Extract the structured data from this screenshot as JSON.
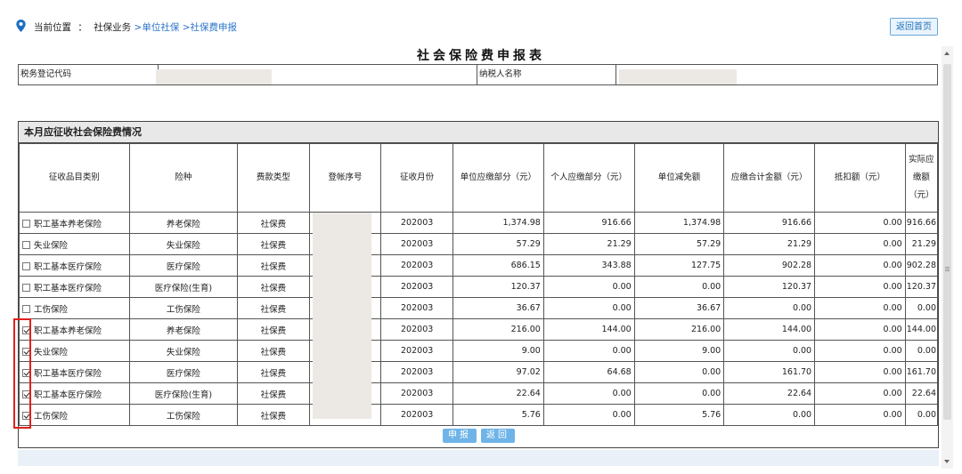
{
  "breadcrumb": {
    "label": "当前位置",
    "colon": "：",
    "static_item": "社保业务",
    "links": [
      ">单位社保",
      ">社保费申报"
    ]
  },
  "header": {
    "home_button": "返回首页"
  },
  "form": {
    "title": "社会保险费申报表",
    "tax_code_label": "税务登记代码",
    "taxpayer_name_label": "纳税人名称"
  },
  "section": {
    "title": "本月应征收社会保险费情况",
    "columns": [
      "征收品目类别",
      "险种",
      "费款类型",
      "登帐序号",
      "征收月份",
      "单位应缴部分（元）",
      "个人应缴部分（元）",
      "单位减免额",
      "应缴合计金额（元）",
      "抵扣额（元）",
      "实际应缴额（元）"
    ],
    "rows": [
      {
        "checked": false,
        "category": "职工基本养老保险",
        "insurance": "养老保险",
        "fee_type": "社保费",
        "month": "202003",
        "unit": "1,374.98",
        "personal": "916.66",
        "unit_relief": "1,374.98",
        "total": "916.66",
        "deduction": "0.00",
        "actual": "916.66"
      },
      {
        "checked": false,
        "category": "失业保险",
        "insurance": "失业保险",
        "fee_type": "社保费",
        "month": "202003",
        "unit": "57.29",
        "personal": "21.29",
        "unit_relief": "57.29",
        "total": "21.29",
        "deduction": "0.00",
        "actual": "21.29"
      },
      {
        "checked": false,
        "category": "职工基本医疗保险",
        "insurance": "医疗保险",
        "fee_type": "社保费",
        "month": "202003",
        "unit": "686.15",
        "personal": "343.88",
        "unit_relief": "127.75",
        "total": "902.28",
        "deduction": "0.00",
        "actual": "902.28"
      },
      {
        "checked": false,
        "category": "职工基本医疗保险",
        "insurance": "医疗保险(生育)",
        "fee_type": "社保费",
        "month": "202003",
        "unit": "120.37",
        "personal": "0.00",
        "unit_relief": "0.00",
        "total": "120.37",
        "deduction": "0.00",
        "actual": "120.37"
      },
      {
        "checked": false,
        "category": "工伤保险",
        "insurance": "工伤保险",
        "fee_type": "社保费",
        "month": "202003",
        "unit": "36.67",
        "personal": "0.00",
        "unit_relief": "36.67",
        "total": "0.00",
        "deduction": "0.00",
        "actual": "0.00"
      },
      {
        "checked": true,
        "category": "职工基本养老保险",
        "insurance": "养老保险",
        "fee_type": "社保费",
        "month": "202003",
        "unit": "216.00",
        "personal": "144.00",
        "unit_relief": "216.00",
        "total": "144.00",
        "deduction": "0.00",
        "actual": "144.00"
      },
      {
        "checked": true,
        "category": "失业保险",
        "insurance": "失业保险",
        "fee_type": "社保费",
        "month": "202003",
        "unit": "9.00",
        "personal": "0.00",
        "unit_relief": "9.00",
        "total": "0.00",
        "deduction": "0.00",
        "actual": "0.00"
      },
      {
        "checked": true,
        "category": "职工基本医疗保险",
        "insurance": "医疗保险",
        "fee_type": "社保费",
        "month": "202003",
        "unit": "97.02",
        "personal": "64.68",
        "unit_relief": "0.00",
        "total": "161.70",
        "deduction": "0.00",
        "actual": "161.70"
      },
      {
        "checked": true,
        "category": "职工基本医疗保险",
        "insurance": "医疗保险(生育)",
        "fee_type": "社保费",
        "month": "202003",
        "unit": "22.64",
        "personal": "0.00",
        "unit_relief": "0.00",
        "total": "22.64",
        "deduction": "0.00",
        "actual": "22.64"
      },
      {
        "checked": true,
        "category": "工伤保险",
        "insurance": "工伤保险",
        "fee_type": "社保费",
        "month": "202003",
        "unit": "5.76",
        "personal": "0.00",
        "unit_relief": "5.76",
        "total": "0.00",
        "deduction": "0.00",
        "actual": "0.00"
      }
    ]
  },
  "actions": {
    "submit": "申报",
    "back": "返回"
  },
  "colors": {
    "link": "#2a73c8",
    "button": "#6fb4e8",
    "highlight": "#e0201a",
    "mask": "#ece9e4"
  },
  "icons": {
    "location": "location-pin-icon"
  }
}
